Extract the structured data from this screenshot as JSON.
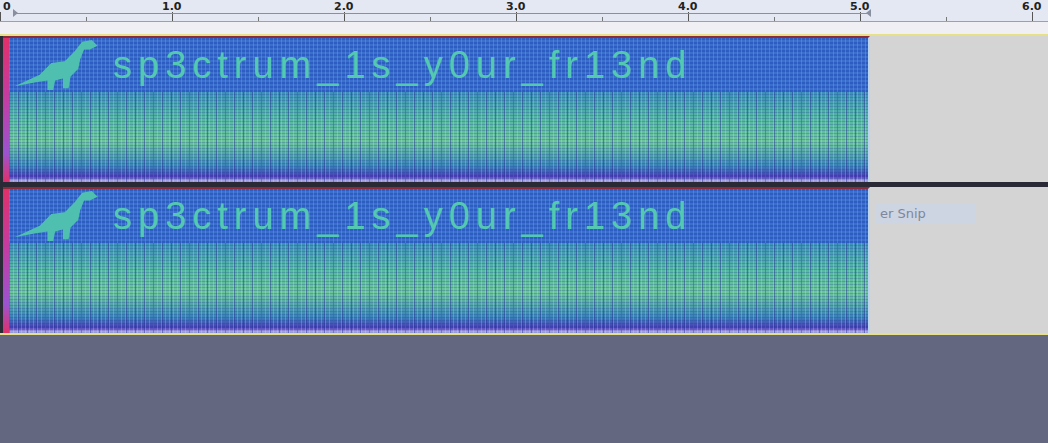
{
  "ruler": {
    "ticks": [
      "0",
      "1.0",
      "2.0",
      "3.0",
      "4.0",
      "5.0",
      "6.0"
    ]
  },
  "channels": [
    {
      "spectrogram_text": "sp3ctrum_1s_y0ur_fr13nd",
      "ghost_label": ""
    },
    {
      "spectrogram_text": "sp3ctrum_1s_y0ur_fr13nd",
      "ghost_label": "er Snip"
    }
  ]
}
